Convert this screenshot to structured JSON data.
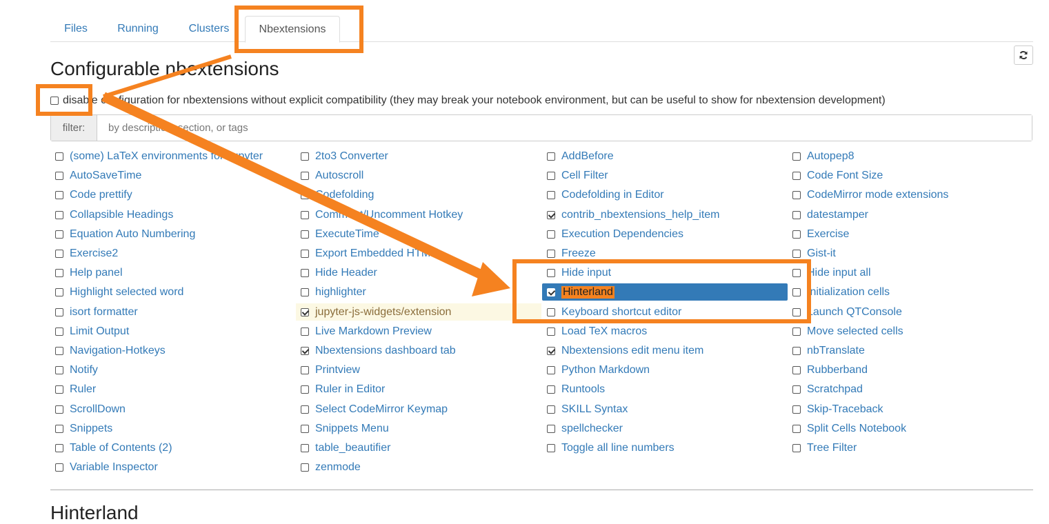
{
  "tabs": [
    {
      "label": "Files",
      "active": false
    },
    {
      "label": "Running",
      "active": false
    },
    {
      "label": "Clusters",
      "active": false
    },
    {
      "label": "Nbextensions",
      "active": true
    }
  ],
  "page_title": "Configurable nbextensions",
  "compat_label": "disable configuration for nbextensions without explicit compatibility (they may break your notebook environment, but can be useful to show for nbextension development)",
  "filter": {
    "label": "filter:",
    "placeholder": "by description, section, or tags",
    "value": ""
  },
  "columns": [
    [
      {
        "label": "(some) LaTeX environments for Jupyter",
        "checked": false
      },
      {
        "label": "AutoSaveTime",
        "checked": false
      },
      {
        "label": "Code prettify",
        "checked": false
      },
      {
        "label": "Collapsible Headings",
        "checked": false
      },
      {
        "label": "Equation Auto Numbering",
        "checked": false
      },
      {
        "label": "Exercise2",
        "checked": false
      },
      {
        "label": "Help panel",
        "checked": false
      },
      {
        "label": "Highlight selected word",
        "checked": false
      },
      {
        "label": "isort formatter",
        "checked": false
      },
      {
        "label": "Limit Output",
        "checked": false
      },
      {
        "label": "Navigation-Hotkeys",
        "checked": false
      },
      {
        "label": "Notify",
        "checked": false
      },
      {
        "label": "Ruler",
        "checked": false
      },
      {
        "label": "ScrollDown",
        "checked": false
      },
      {
        "label": "Snippets",
        "checked": false
      },
      {
        "label": "Table of Contents (2)",
        "checked": false
      },
      {
        "label": "Variable Inspector",
        "checked": false
      }
    ],
    [
      {
        "label": "2to3 Converter",
        "checked": false
      },
      {
        "label": "Autoscroll",
        "checked": false
      },
      {
        "label": "Codefolding",
        "checked": false
      },
      {
        "label": "Comment/Uncomment Hotkey",
        "checked": false
      },
      {
        "label": "ExecuteTime",
        "checked": false
      },
      {
        "label": "Export Embedded HTML",
        "checked": false
      },
      {
        "label": "Hide Header",
        "checked": false
      },
      {
        "label": "highlighter",
        "checked": false
      },
      {
        "label": "jupyter-js-widgets/extension",
        "checked": true,
        "incompatible": true
      },
      {
        "label": "Live Markdown Preview",
        "checked": false
      },
      {
        "label": "Nbextensions dashboard tab",
        "checked": true
      },
      {
        "label": "Printview",
        "checked": false
      },
      {
        "label": "Ruler in Editor",
        "checked": false
      },
      {
        "label": "Select CodeMirror Keymap",
        "checked": false
      },
      {
        "label": "Snippets Menu",
        "checked": false
      },
      {
        "label": "table_beautifier",
        "checked": false
      },
      {
        "label": "zenmode",
        "checked": false
      }
    ],
    [
      {
        "label": "AddBefore",
        "checked": false
      },
      {
        "label": "Cell Filter",
        "checked": false
      },
      {
        "label": "Codefolding in Editor",
        "checked": false
      },
      {
        "label": "contrib_nbextensions_help_item",
        "checked": true
      },
      {
        "label": "Execution Dependencies",
        "checked": false
      },
      {
        "label": "Freeze",
        "checked": false
      },
      {
        "label": "Hide input",
        "checked": false
      },
      {
        "label": "Hinterland",
        "checked": true,
        "selected": true
      },
      {
        "label": "Keyboard shortcut editor",
        "checked": false
      },
      {
        "label": "Load TeX macros",
        "checked": false
      },
      {
        "label": "Nbextensions edit menu item",
        "checked": true
      },
      {
        "label": "Python Markdown",
        "checked": false
      },
      {
        "label": "Runtools",
        "checked": false
      },
      {
        "label": "SKILL Syntax",
        "checked": false
      },
      {
        "label": "spellchecker",
        "checked": false
      },
      {
        "label": "Toggle all line numbers",
        "checked": false
      }
    ],
    [
      {
        "label": "Autopep8",
        "checked": false
      },
      {
        "label": "Code Font Size",
        "checked": false
      },
      {
        "label": "CodeMirror mode extensions",
        "checked": false
      },
      {
        "label": "datestamper",
        "checked": false
      },
      {
        "label": "Exercise",
        "checked": false
      },
      {
        "label": "Gist-it",
        "checked": false
      },
      {
        "label": "Hide input all",
        "checked": false
      },
      {
        "label": "Initialization cells",
        "checked": false
      },
      {
        "label": "Launch QTConsole",
        "checked": false
      },
      {
        "label": "Move selected cells",
        "checked": false
      },
      {
        "label": "nbTranslate",
        "checked": false
      },
      {
        "label": "Rubberband",
        "checked": false
      },
      {
        "label": "Scratchpad",
        "checked": false
      },
      {
        "label": "Skip-Traceback",
        "checked": false
      },
      {
        "label": "Split Cells Notebook",
        "checked": false
      },
      {
        "label": "Tree Filter",
        "checked": false
      }
    ]
  ],
  "section_title": "Hinterland",
  "colors": {
    "link": "#337ab7",
    "annotation": "#f58220",
    "selected_bg": "#337ab7",
    "incompat_bg": "#fcf8e3"
  },
  "icons": {
    "refresh": "refresh-icon"
  }
}
